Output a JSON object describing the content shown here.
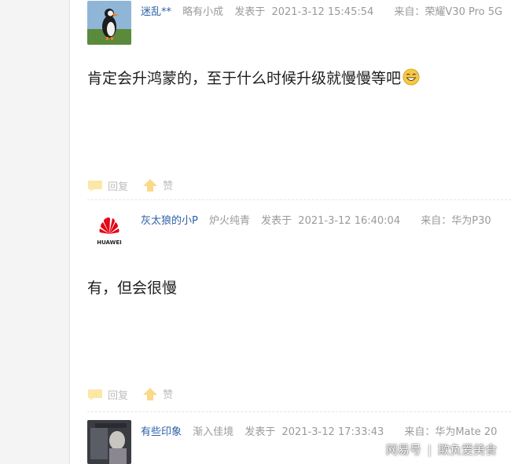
{
  "posts": [
    {
      "username": "迷乱**",
      "rank": "略有小成",
      "posted_label": "发表于",
      "datetime": "2021-3-12 15:45:54",
      "source": "来自：荣耀V30 Pro 5G",
      "content": "肯定会升鸿蒙的，至于什么时候升级就慢慢等吧",
      "emoji": "grinning-sweat-emoji",
      "reply_label": "回复",
      "like_label": "赞"
    },
    {
      "username": "灰太狼的小P",
      "rank": "炉火纯青",
      "posted_label": "发表于",
      "datetime": "2021-3-12 16:40:04",
      "source": "来自：华为P30",
      "content": "有，但会很慢",
      "avatar_logo_text": "HUAWEI",
      "reply_label": "回复",
      "like_label": "赞"
    },
    {
      "username": "有些印象",
      "rank": "渐入佳境",
      "posted_label": "发表于",
      "datetime": "2021-3-12 17:33:43",
      "source": "来自：华为Mate 20"
    }
  ],
  "watermark": {
    "brand": "网易号",
    "account": "欺负爱美食"
  },
  "colors": {
    "username": "#2b5fa8",
    "meta": "#9a9a9a",
    "action": "#bdbdbd",
    "huawei_red": "#e60012"
  }
}
